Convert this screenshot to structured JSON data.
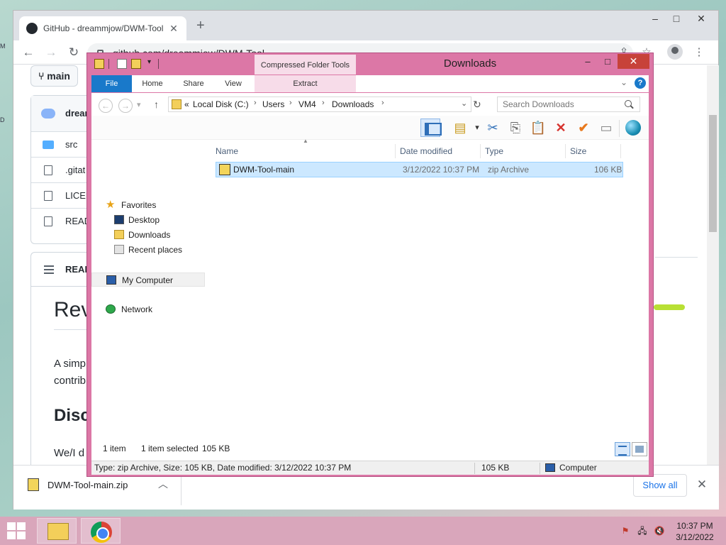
{
  "chrome": {
    "tab_title": "GitHub - dreammjow/DWM-Tool",
    "url": "github.com/dreammjow/DWM-Tool",
    "branch": "main",
    "repo_header": "dream",
    "files": [
      "src",
      ".gitat",
      "LICEN",
      "READ"
    ],
    "readme_header": "READ",
    "h1": "Rev",
    "p_line1": "A simp",
    "p_line2": "contrib",
    "h2": "Disc",
    "p2": "We/I d",
    "download_name": "DWM-Tool-main.zip",
    "show_all": "Show all"
  },
  "explorer": {
    "title": "Downloads",
    "context_tab": "Compressed Folder Tools",
    "ribbon_tabs": [
      "File",
      "Home",
      "Share",
      "View"
    ],
    "context_subtab": "Extract",
    "breadcrumb_overflow": "«",
    "breadcrumb": [
      "Local Disk (C:)",
      "Users",
      "VM4",
      "Downloads"
    ],
    "search_placeholder": "Search Downloads",
    "nav": {
      "favorites": "Favorites",
      "favorites_items": [
        "Desktop",
        "Downloads",
        "Recent places"
      ],
      "computer": "My Computer",
      "network": "Network"
    },
    "columns": [
      "Name",
      "Date modified",
      "Type",
      "Size"
    ],
    "files": [
      {
        "name": "DWM-Tool-main",
        "date": "3/12/2022 10:37 PM",
        "type": "zip Archive",
        "size": "106 KB"
      }
    ],
    "status": {
      "count": "1 item",
      "selected": "1 item selected",
      "selected_size": "105 KB"
    },
    "details": {
      "info": "Type: zip Archive, Size: 105 KB, Date modified: 3/12/2022 10:37 PM",
      "size": "105 KB",
      "location": "Computer"
    }
  },
  "taskbar": {
    "time": "10:37 PM",
    "date": "3/12/2022"
  },
  "icons": {
    "start": "windows-start-icon",
    "explorer": "file-explorer-icon",
    "chrome": "chrome-icon"
  }
}
